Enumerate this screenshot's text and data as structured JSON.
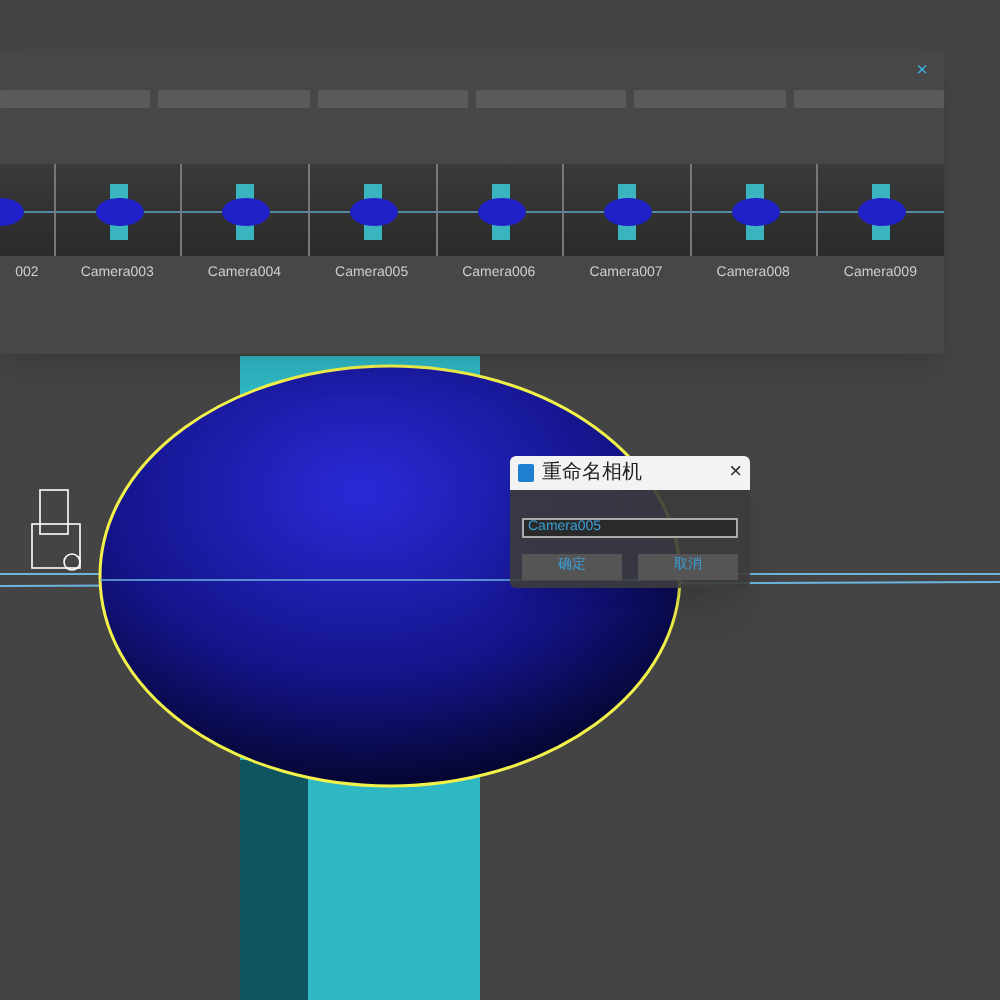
{
  "camera_panel": {
    "close": "×",
    "thumbnails": [
      {
        "label": "002",
        "selected": false
      },
      {
        "label": "Camera003",
        "selected": false
      },
      {
        "label": "Camera004",
        "selected": false
      },
      {
        "label": "Camera005",
        "selected": false
      },
      {
        "label": "Camera006",
        "selected": false
      },
      {
        "label": "Camera007",
        "selected": false
      },
      {
        "label": "Camera008",
        "selected": false
      },
      {
        "label": "Camera009",
        "selected": false
      }
    ]
  },
  "rename_dialog": {
    "title": "重命名相机",
    "close": "×",
    "value": "Camera005",
    "buttons": [
      "确定",
      "取消"
    ]
  }
}
